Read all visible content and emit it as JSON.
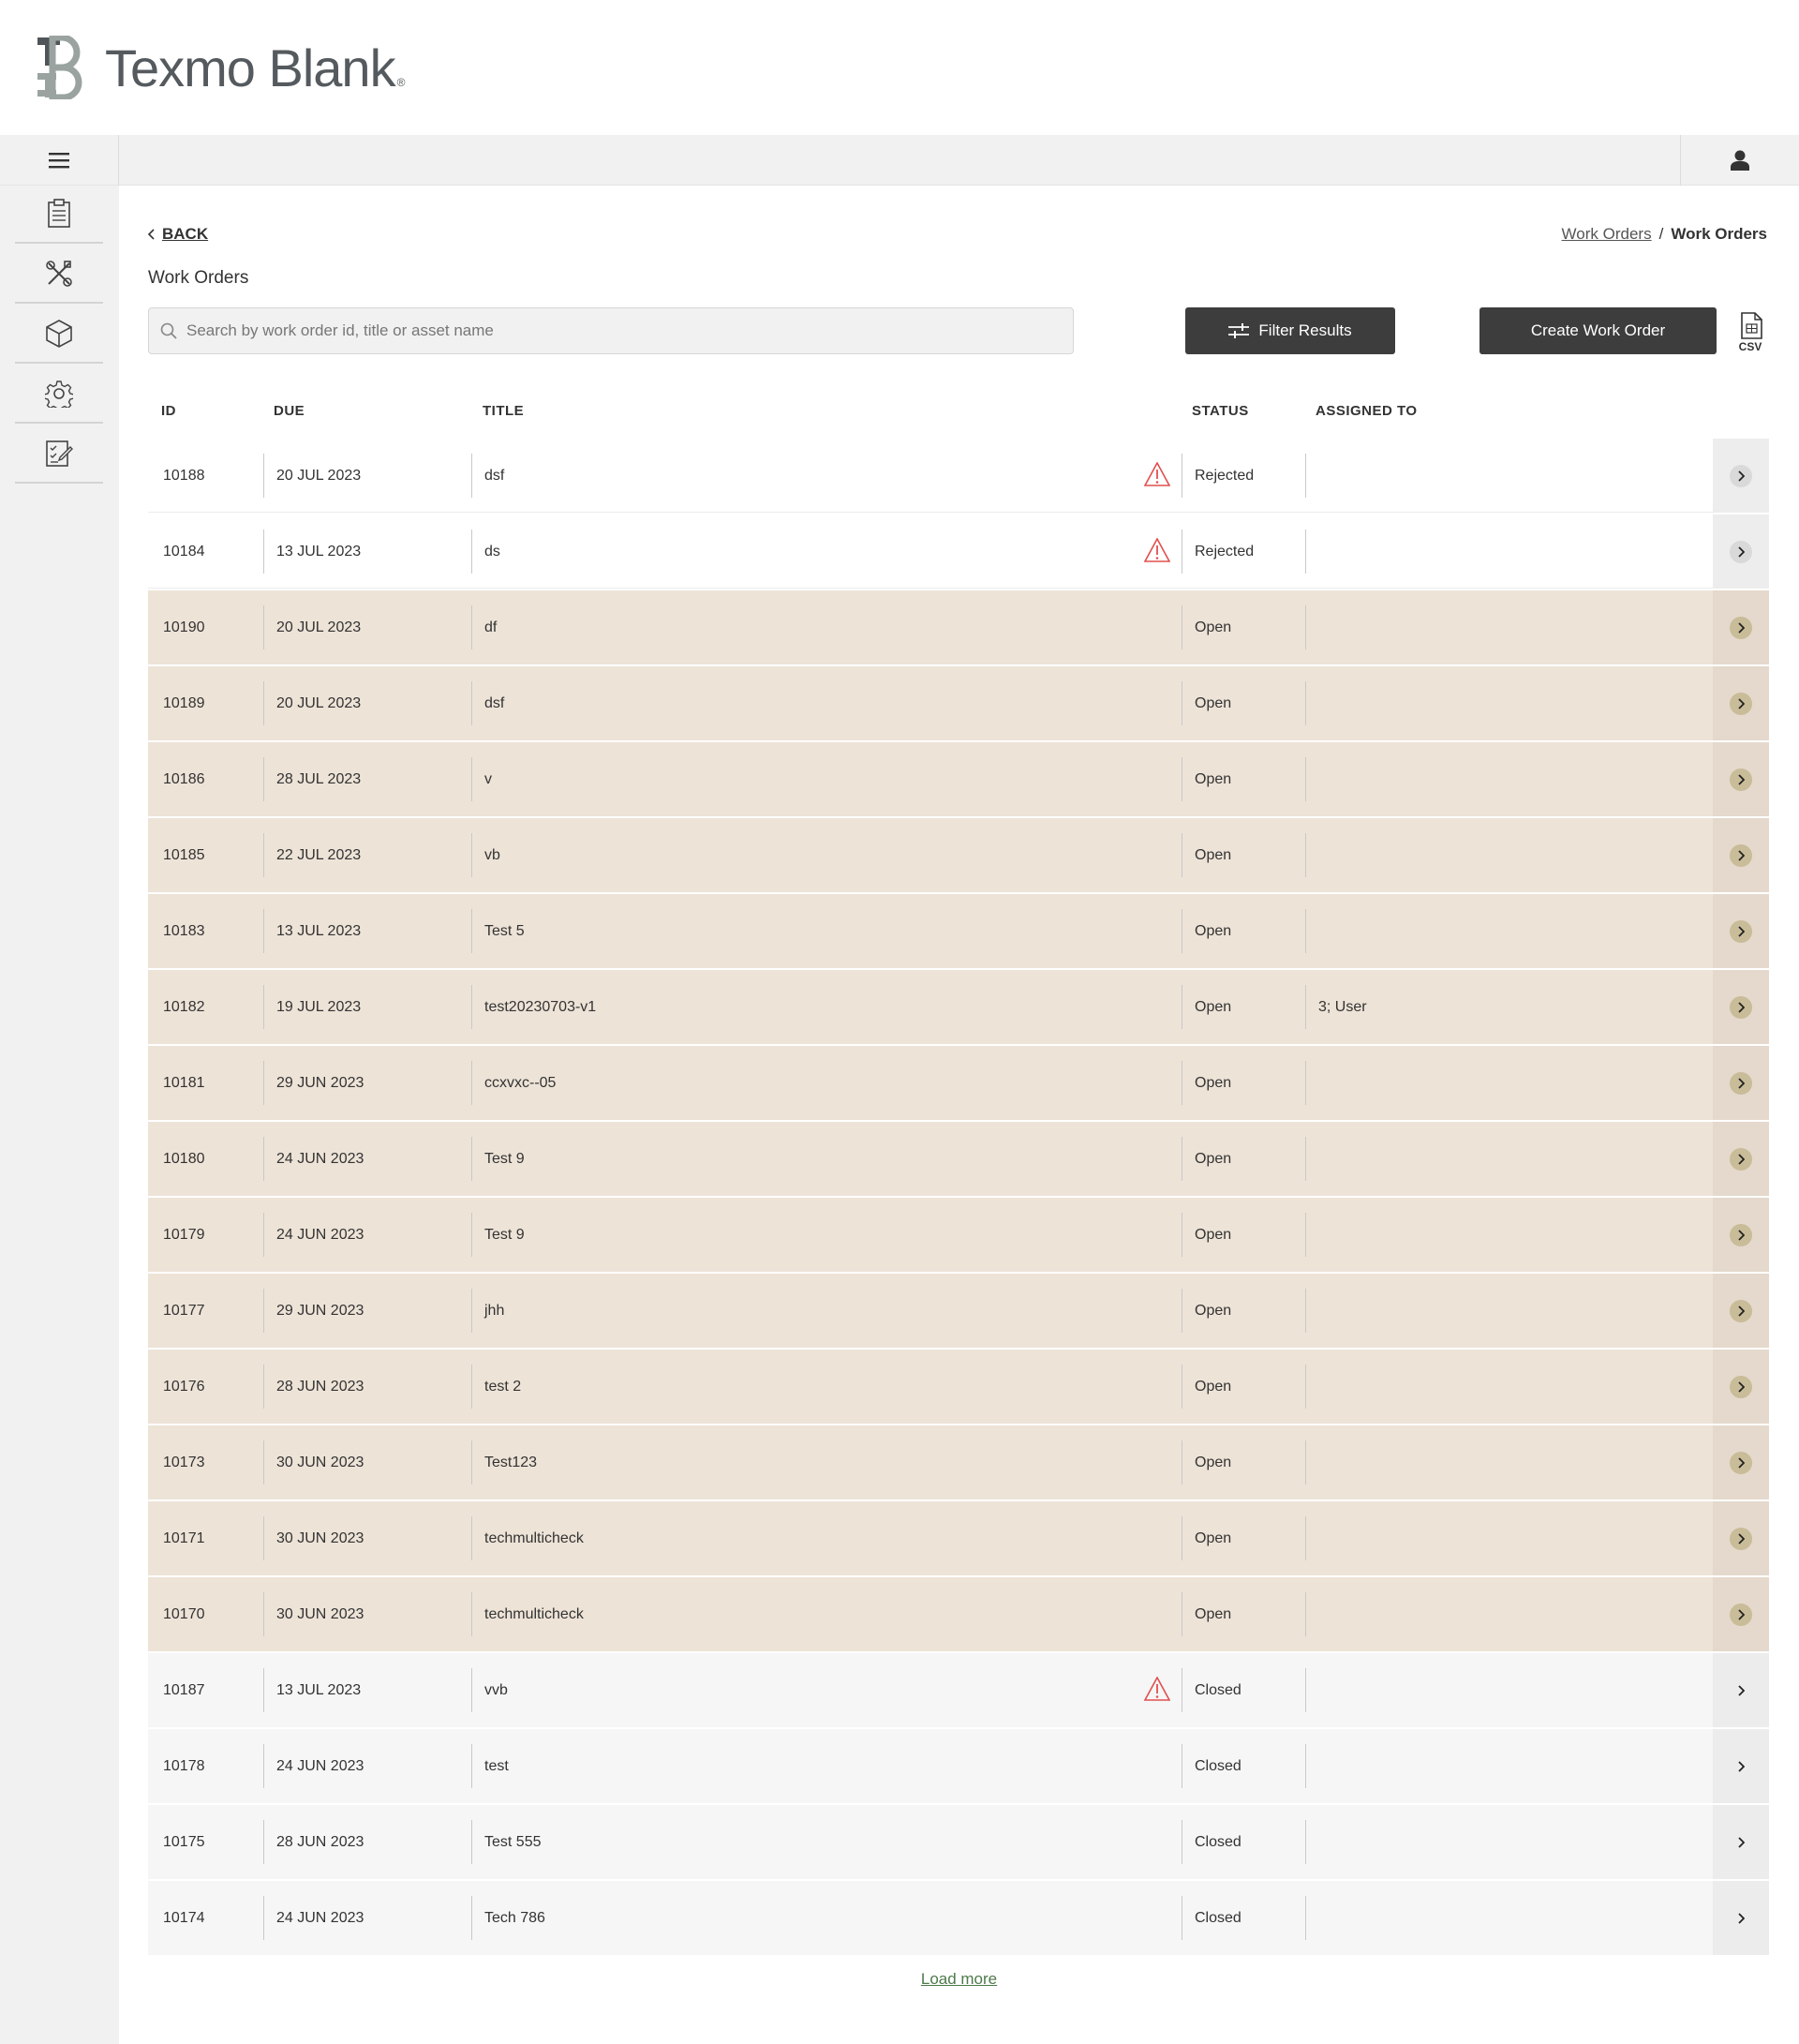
{
  "brand": {
    "name": "Texmo Blank",
    "mark": "TB",
    "registered": "®"
  },
  "topbar": {
    "menu_icon": "hamburger-icon",
    "user_icon": "user-icon"
  },
  "sidebar": {
    "items": [
      {
        "icon": "clipboard-icon"
      },
      {
        "icon": "tools-icon"
      },
      {
        "icon": "box-icon"
      },
      {
        "icon": "gear-icon"
      },
      {
        "icon": "checklist-edit-icon"
      }
    ]
  },
  "nav": {
    "back_label": "BACK",
    "breadcrumb": {
      "link": "Work Orders",
      "separator": "/",
      "current": "Work Orders"
    }
  },
  "page": {
    "title": "Work Orders"
  },
  "search": {
    "placeholder": "Search by work order id, title or asset name",
    "value": ""
  },
  "actions": {
    "filter_label": "Filter Results",
    "create_label": "Create Work Order",
    "csv_label": "CSV"
  },
  "table": {
    "columns": {
      "id": "ID",
      "due": "DUE",
      "title": "TITLE",
      "status": "STATUS",
      "assigned": "ASSIGNED TO"
    },
    "rows": [
      {
        "id": "10188",
        "due": "20 JUL 2023",
        "title": "dsf",
        "status": "Rejected",
        "assigned": "",
        "warning": true,
        "kind": "red"
      },
      {
        "id": "10184",
        "due": "13 JUL 2023",
        "title": "ds",
        "status": "Rejected",
        "assigned": "",
        "warning": true,
        "kind": "red"
      },
      {
        "id": "10190",
        "due": "20 JUL 2023",
        "title": "df",
        "status": "Open",
        "assigned": "",
        "warning": false,
        "kind": "open"
      },
      {
        "id": "10189",
        "due": "20 JUL 2023",
        "title": "dsf",
        "status": "Open",
        "assigned": "",
        "warning": false,
        "kind": "open"
      },
      {
        "id": "10186",
        "due": "28 JUL 2023",
        "title": "v",
        "status": "Open",
        "assigned": "",
        "warning": false,
        "kind": "open"
      },
      {
        "id": "10185",
        "due": "22 JUL 2023",
        "title": "vb",
        "status": "Open",
        "assigned": "",
        "warning": false,
        "kind": "open"
      },
      {
        "id": "10183",
        "due": "13 JUL 2023",
        "title": "Test 5",
        "status": "Open",
        "assigned": "",
        "warning": false,
        "kind": "open"
      },
      {
        "id": "10182",
        "due": "19 JUL 2023",
        "title": "test20230703-v1",
        "status": "Open",
        "assigned": "3; User",
        "warning": false,
        "kind": "open"
      },
      {
        "id": "10181",
        "due": "29 JUN 2023",
        "title": "ccxvxc--05",
        "status": "Open",
        "assigned": "",
        "warning": false,
        "kind": "open"
      },
      {
        "id": "10180",
        "due": "24 JUN 2023",
        "title": "Test 9",
        "status": "Open",
        "assigned": "",
        "warning": false,
        "kind": "open"
      },
      {
        "id": "10179",
        "due": "24 JUN 2023",
        "title": "Test 9",
        "status": "Open",
        "assigned": "",
        "warning": false,
        "kind": "open"
      },
      {
        "id": "10177",
        "due": "29 JUN 2023",
        "title": "jhh",
        "status": "Open",
        "assigned": "",
        "warning": false,
        "kind": "open"
      },
      {
        "id": "10176",
        "due": "28 JUN 2023",
        "title": "test 2",
        "status": "Open",
        "assigned": "",
        "warning": false,
        "kind": "open"
      },
      {
        "id": "10173",
        "due": "30 JUN 2023",
        "title": "Test123",
        "status": "Open",
        "assigned": "",
        "warning": false,
        "kind": "open"
      },
      {
        "id": "10171",
        "due": "30 JUN 2023",
        "title": "techmulticheck",
        "status": "Open",
        "assigned": "",
        "warning": false,
        "kind": "open"
      },
      {
        "id": "10170",
        "due": "30 JUN 2023",
        "title": "techmulticheck",
        "status": "Open",
        "assigned": "",
        "warning": false,
        "kind": "open"
      },
      {
        "id": "10187",
        "due": "13 JUL 2023",
        "title": "vvb",
        "status": "Closed",
        "assigned": "",
        "warning": true,
        "kind": "closed"
      },
      {
        "id": "10178",
        "due": "24 JUN 2023",
        "title": "test",
        "status": "Closed",
        "assigned": "",
        "warning": false,
        "kind": "closed"
      },
      {
        "id": "10175",
        "due": "28 JUN 2023",
        "title": "Test 555",
        "status": "Closed",
        "assigned": "",
        "warning": false,
        "kind": "closed"
      },
      {
        "id": "10174",
        "due": "24 JUN 2023",
        "title": "Tech 786",
        "status": "Closed",
        "assigned": "",
        "warning": false,
        "kind": "closed"
      }
    ],
    "load_more_label": "Load more"
  },
  "colors": {
    "open_row": "#ede3d7",
    "closed_row": "#f6f6f6",
    "warning": "#e05050",
    "button_dark": "#3d3d3d",
    "link_green": "#4e7a4b"
  }
}
